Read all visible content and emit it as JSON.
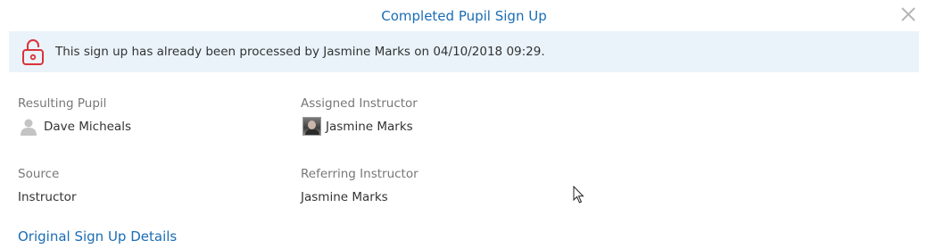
{
  "modal": {
    "title": "Completed Pupil Sign Up",
    "close_icon": "close-icon"
  },
  "notice": {
    "icon": "lock-icon",
    "text": "This sign up has already been processed by Jasmine Marks on 04/10/2018 09:29.",
    "background": "#eaf3fa",
    "icon_color": "#d9343b"
  },
  "fields": {
    "resulting_pupil": {
      "label": "Resulting Pupil",
      "value": "Dave Micheals",
      "icon": "person-icon"
    },
    "assigned_instructor": {
      "label": "Assigned Instructor",
      "value": "Jasmine Marks",
      "icon": "avatar"
    },
    "source": {
      "label": "Source",
      "value": "Instructor"
    },
    "referring_instructor": {
      "label": "Referring Instructor",
      "value": "Jasmine Marks"
    }
  },
  "section": {
    "title": "Original Sign Up Details"
  },
  "colors": {
    "accent": "#1a6db5",
    "label": "#777777",
    "text": "#333333"
  }
}
